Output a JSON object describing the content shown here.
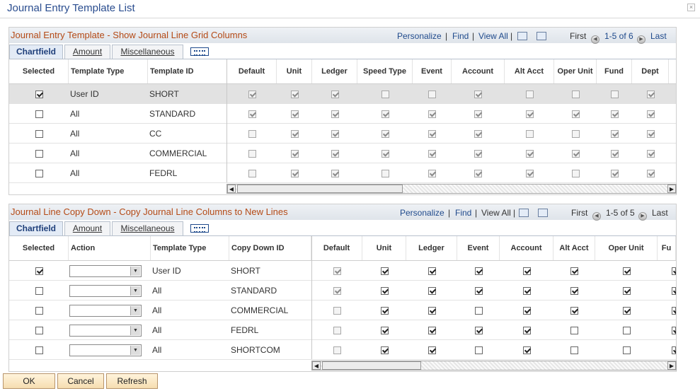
{
  "page_title": "Journal Entry Template List",
  "close_icon": "close-icon",
  "grid1": {
    "title": "Journal Entry Template - Show Journal Line Grid Columns",
    "personalize": "Personalize",
    "find": "Find",
    "view_all": "View All",
    "first": "First",
    "range": "1-5 of 6",
    "last": "Last",
    "tabs": [
      "Chartfield",
      "Amount",
      "Miscellaneous"
    ],
    "columns": [
      "Selected",
      "Template Type",
      "Template ID",
      "Default",
      "Unit",
      "Ledger",
      "Speed Type",
      "Event",
      "Account",
      "Alt Acct",
      "Oper Unit",
      "Fund",
      "Dept"
    ],
    "rows": [
      {
        "selected": true,
        "type": "User ID",
        "id": "SHORT",
        "flags": [
          true,
          true,
          true,
          false,
          false,
          true,
          false,
          false,
          false,
          true
        ]
      },
      {
        "selected": false,
        "type": "All",
        "id": "STANDARD",
        "flags": [
          true,
          true,
          true,
          true,
          true,
          true,
          true,
          true,
          true,
          true
        ]
      },
      {
        "selected": false,
        "type": "All",
        "id": "CC",
        "flags": [
          false,
          true,
          true,
          true,
          true,
          true,
          false,
          false,
          true,
          true
        ]
      },
      {
        "selected": false,
        "type": "All",
        "id": "COMMERCIAL",
        "flags": [
          false,
          true,
          true,
          true,
          true,
          true,
          true,
          true,
          true,
          true
        ]
      },
      {
        "selected": false,
        "type": "All",
        "id": "FEDRL",
        "flags": [
          false,
          true,
          true,
          false,
          true,
          true,
          true,
          false,
          true,
          true
        ]
      }
    ]
  },
  "grid2": {
    "title": "Journal Line Copy Down - Copy Journal Line Columns to New Lines",
    "personalize": "Personalize",
    "find": "Find",
    "view_all": "View All",
    "first": "First",
    "range": "1-5 of 5",
    "last": "Last",
    "tabs": [
      "Chartfield",
      "Amount",
      "Miscellaneous"
    ],
    "columns": [
      "Selected",
      "Action",
      "Template Type",
      "Copy Down ID",
      "Default",
      "Unit",
      "Ledger",
      "Event",
      "Account",
      "Alt Acct",
      "Oper Unit",
      "Fu"
    ],
    "rows": [
      {
        "selected": true,
        "action": "",
        "type": "User ID",
        "id": "SHORT",
        "flags": [
          true,
          true,
          true,
          true,
          true,
          true,
          true
        ]
      },
      {
        "selected": false,
        "action": "",
        "type": "All",
        "id": "STANDARD",
        "flags": [
          true,
          true,
          true,
          true,
          true,
          true,
          true
        ]
      },
      {
        "selected": false,
        "action": "",
        "type": "All",
        "id": "COMMERCIAL",
        "flags": [
          false,
          true,
          true,
          false,
          true,
          true,
          true
        ]
      },
      {
        "selected": false,
        "action": "",
        "type": "All",
        "id": "FEDRL",
        "flags": [
          false,
          true,
          true,
          true,
          true,
          false,
          false
        ]
      },
      {
        "selected": false,
        "action": "",
        "type": "All",
        "id": "SHORTCOM",
        "flags": [
          false,
          true,
          true,
          false,
          true,
          false,
          false
        ]
      }
    ]
  },
  "buttons": {
    "ok": "OK",
    "cancel": "Cancel",
    "refresh": "Refresh"
  }
}
